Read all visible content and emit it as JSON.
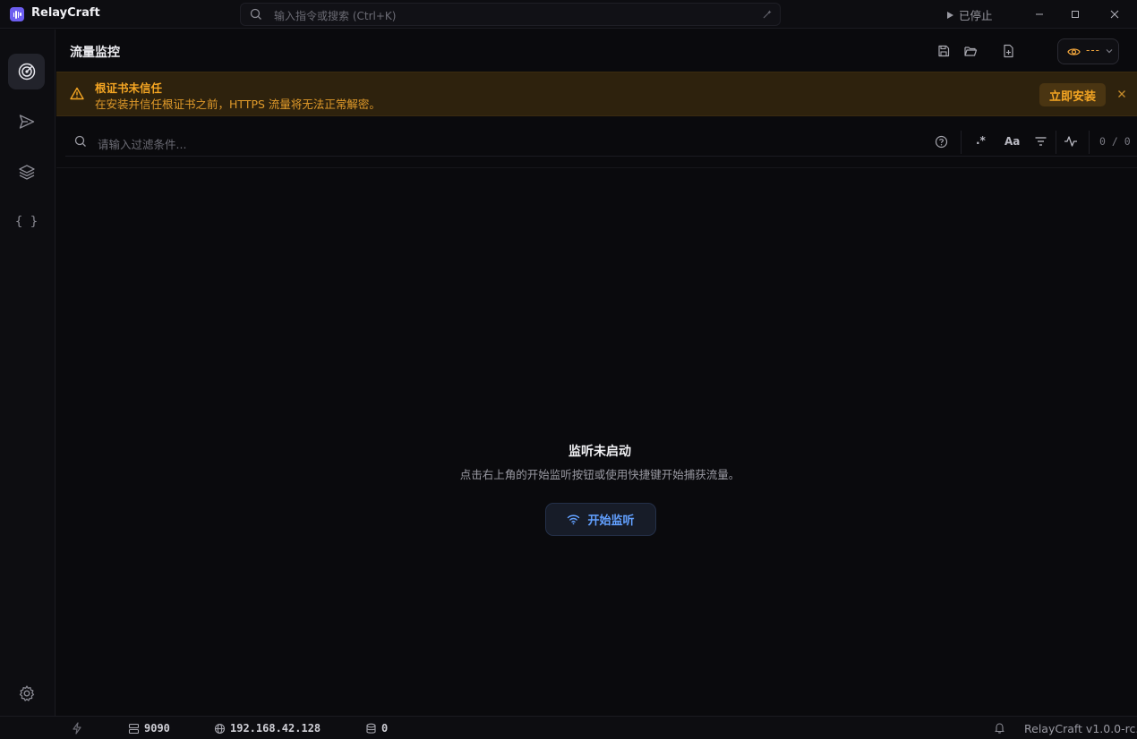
{
  "app": {
    "name": "RelayCraft",
    "version": "RelayCraft v1.0.0-rc.2"
  },
  "titlebar": {
    "search_placeholder": "输入指令或搜索 (Ctrl+K)",
    "status_label": "已停止"
  },
  "header": {
    "title": "流量监控",
    "view_mode_value": "---"
  },
  "banner": {
    "title": "根证书未信任",
    "message": "在安装并信任根证书之前，HTTPS 流量将无法正常解密。",
    "install_label": "立即安装"
  },
  "filter": {
    "placeholder": "请输入过滤条件...",
    "regex_label": ".*",
    "case_label": "Aa",
    "count": "0 / 0"
  },
  "empty": {
    "title": "监听未启动",
    "description": "点击右上角的开始监听按钮或使用快捷键开始捕获流量。",
    "start_label": "开始监听"
  },
  "statusbar": {
    "port": "9090",
    "ip": "192.168.42.128",
    "count": "0"
  },
  "sidebar": {
    "items": [
      {
        "name": "traffic",
        "icon": "radar-icon",
        "active": true
      },
      {
        "name": "composer",
        "icon": "send-icon",
        "active": false
      },
      {
        "name": "rules",
        "icon": "layers-icon",
        "active": false
      },
      {
        "name": "scripts",
        "icon": "braces-icon",
        "active": false,
        "glyph": "{ }"
      }
    ]
  },
  "colors": {
    "accent": "#6d5ef0",
    "warning": "#f5a623",
    "link": "#62a0ff"
  }
}
